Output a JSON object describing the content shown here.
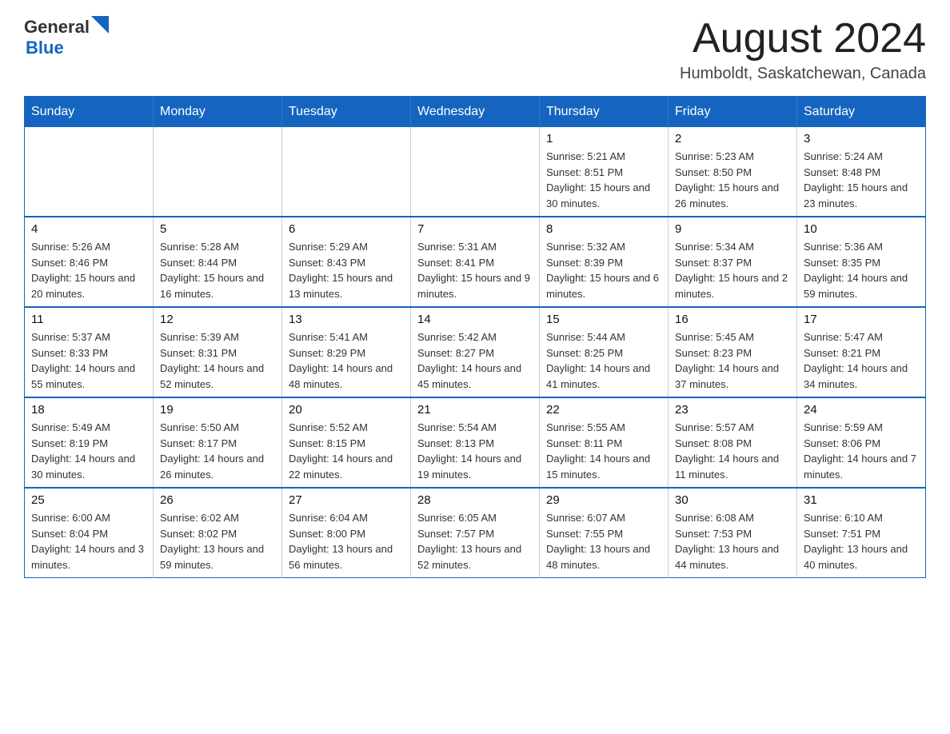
{
  "header": {
    "logo_general": "General",
    "logo_blue": "Blue",
    "main_title": "August 2024",
    "subtitle": "Humboldt, Saskatchewan, Canada"
  },
  "calendar": {
    "days_of_week": [
      "Sunday",
      "Monday",
      "Tuesday",
      "Wednesday",
      "Thursday",
      "Friday",
      "Saturday"
    ],
    "weeks": [
      [
        {
          "day": "",
          "info": ""
        },
        {
          "day": "",
          "info": ""
        },
        {
          "day": "",
          "info": ""
        },
        {
          "day": "",
          "info": ""
        },
        {
          "day": "1",
          "info": "Sunrise: 5:21 AM\nSunset: 8:51 PM\nDaylight: 15 hours and 30 minutes."
        },
        {
          "day": "2",
          "info": "Sunrise: 5:23 AM\nSunset: 8:50 PM\nDaylight: 15 hours and 26 minutes."
        },
        {
          "day": "3",
          "info": "Sunrise: 5:24 AM\nSunset: 8:48 PM\nDaylight: 15 hours and 23 minutes."
        }
      ],
      [
        {
          "day": "4",
          "info": "Sunrise: 5:26 AM\nSunset: 8:46 PM\nDaylight: 15 hours and 20 minutes."
        },
        {
          "day": "5",
          "info": "Sunrise: 5:28 AM\nSunset: 8:44 PM\nDaylight: 15 hours and 16 minutes."
        },
        {
          "day": "6",
          "info": "Sunrise: 5:29 AM\nSunset: 8:43 PM\nDaylight: 15 hours and 13 minutes."
        },
        {
          "day": "7",
          "info": "Sunrise: 5:31 AM\nSunset: 8:41 PM\nDaylight: 15 hours and 9 minutes."
        },
        {
          "day": "8",
          "info": "Sunrise: 5:32 AM\nSunset: 8:39 PM\nDaylight: 15 hours and 6 minutes."
        },
        {
          "day": "9",
          "info": "Sunrise: 5:34 AM\nSunset: 8:37 PM\nDaylight: 15 hours and 2 minutes."
        },
        {
          "day": "10",
          "info": "Sunrise: 5:36 AM\nSunset: 8:35 PM\nDaylight: 14 hours and 59 minutes."
        }
      ],
      [
        {
          "day": "11",
          "info": "Sunrise: 5:37 AM\nSunset: 8:33 PM\nDaylight: 14 hours and 55 minutes."
        },
        {
          "day": "12",
          "info": "Sunrise: 5:39 AM\nSunset: 8:31 PM\nDaylight: 14 hours and 52 minutes."
        },
        {
          "day": "13",
          "info": "Sunrise: 5:41 AM\nSunset: 8:29 PM\nDaylight: 14 hours and 48 minutes."
        },
        {
          "day": "14",
          "info": "Sunrise: 5:42 AM\nSunset: 8:27 PM\nDaylight: 14 hours and 45 minutes."
        },
        {
          "day": "15",
          "info": "Sunrise: 5:44 AM\nSunset: 8:25 PM\nDaylight: 14 hours and 41 minutes."
        },
        {
          "day": "16",
          "info": "Sunrise: 5:45 AM\nSunset: 8:23 PM\nDaylight: 14 hours and 37 minutes."
        },
        {
          "day": "17",
          "info": "Sunrise: 5:47 AM\nSunset: 8:21 PM\nDaylight: 14 hours and 34 minutes."
        }
      ],
      [
        {
          "day": "18",
          "info": "Sunrise: 5:49 AM\nSunset: 8:19 PM\nDaylight: 14 hours and 30 minutes."
        },
        {
          "day": "19",
          "info": "Sunrise: 5:50 AM\nSunset: 8:17 PM\nDaylight: 14 hours and 26 minutes."
        },
        {
          "day": "20",
          "info": "Sunrise: 5:52 AM\nSunset: 8:15 PM\nDaylight: 14 hours and 22 minutes."
        },
        {
          "day": "21",
          "info": "Sunrise: 5:54 AM\nSunset: 8:13 PM\nDaylight: 14 hours and 19 minutes."
        },
        {
          "day": "22",
          "info": "Sunrise: 5:55 AM\nSunset: 8:11 PM\nDaylight: 14 hours and 15 minutes."
        },
        {
          "day": "23",
          "info": "Sunrise: 5:57 AM\nSunset: 8:08 PM\nDaylight: 14 hours and 11 minutes."
        },
        {
          "day": "24",
          "info": "Sunrise: 5:59 AM\nSunset: 8:06 PM\nDaylight: 14 hours and 7 minutes."
        }
      ],
      [
        {
          "day": "25",
          "info": "Sunrise: 6:00 AM\nSunset: 8:04 PM\nDaylight: 14 hours and 3 minutes."
        },
        {
          "day": "26",
          "info": "Sunrise: 6:02 AM\nSunset: 8:02 PM\nDaylight: 13 hours and 59 minutes."
        },
        {
          "day": "27",
          "info": "Sunrise: 6:04 AM\nSunset: 8:00 PM\nDaylight: 13 hours and 56 minutes."
        },
        {
          "day": "28",
          "info": "Sunrise: 6:05 AM\nSunset: 7:57 PM\nDaylight: 13 hours and 52 minutes."
        },
        {
          "day": "29",
          "info": "Sunrise: 6:07 AM\nSunset: 7:55 PM\nDaylight: 13 hours and 48 minutes."
        },
        {
          "day": "30",
          "info": "Sunrise: 6:08 AM\nSunset: 7:53 PM\nDaylight: 13 hours and 44 minutes."
        },
        {
          "day": "31",
          "info": "Sunrise: 6:10 AM\nSunset: 7:51 PM\nDaylight: 13 hours and 40 minutes."
        }
      ]
    ]
  }
}
